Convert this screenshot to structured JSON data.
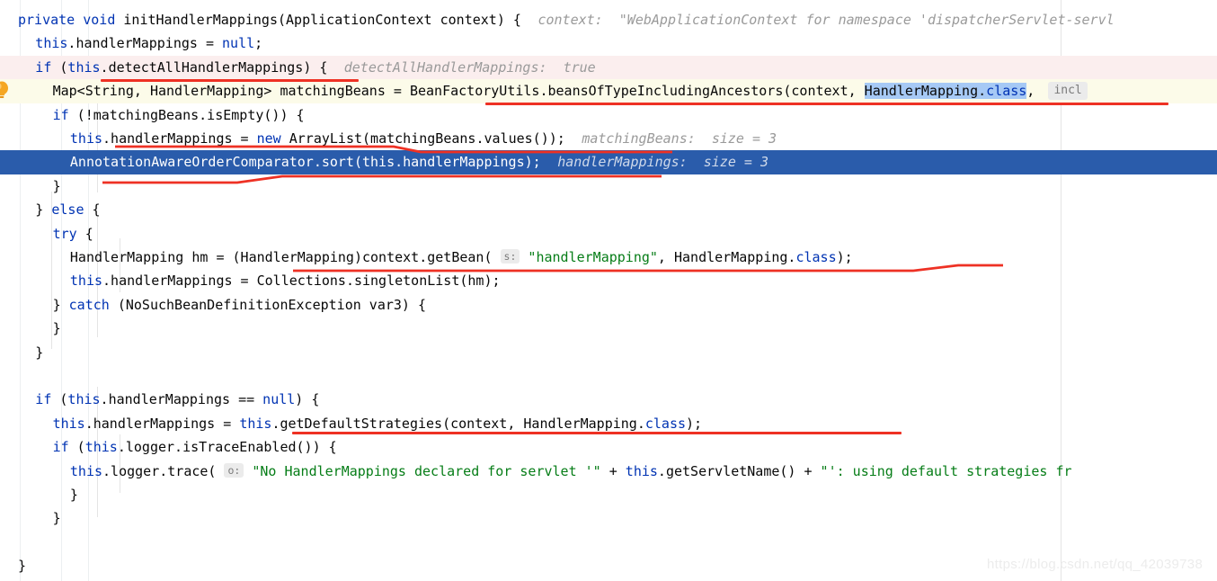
{
  "editor": {
    "language": "java",
    "theme": "IntelliJ Light",
    "colors": {
      "background": "#ffffff",
      "keyword": "#0033b3",
      "string": "#067d17",
      "number": "#1750eb",
      "plain_text": "#080808",
      "inline_hint": "#9a9a9a",
      "selected_line_bg": "#2a5cab",
      "selected_line_fg": "#ffffff",
      "text_selection_bg": "#a6c9f5",
      "breakpoint_hit_row_bg": "#fcfbe9",
      "execution_row_bg": "#fbeeee",
      "annotation_red": "#ee3124",
      "indent_guide": "#e4e4e4",
      "gutter_separator": "#eceff1"
    }
  },
  "gutter": {
    "intention_icon": "lightbulb-icon",
    "intention_icon_color": "#f5a623"
  },
  "watermark": {
    "text": "https://blog.csdn.net/qq_42039738"
  },
  "code_lines": [
    {
      "id": 1,
      "indent": 0,
      "row_style": "normal",
      "tokens": [
        {
          "t": "private",
          "c": "kw"
        },
        {
          "t": " ",
          "c": "plain"
        },
        {
          "t": "void",
          "c": "kw"
        },
        {
          "t": " initHandlerMappings(ApplicationContext context) {",
          "c": "plain"
        }
      ],
      "hint": "context:  \"WebApplicationContext for namespace 'dispatcherServlet-servl"
    },
    {
      "id": 2,
      "indent": 1,
      "row_style": "normal",
      "tokens": [
        {
          "t": "this",
          "c": "kw"
        },
        {
          "t": ".handlerMappings = ",
          "c": "plain"
        },
        {
          "t": "null",
          "c": "kw"
        },
        {
          "t": ";",
          "c": "plain"
        }
      ],
      "hint": ""
    },
    {
      "id": 3,
      "indent": 1,
      "row_style": "pink",
      "tokens": [
        {
          "t": "if",
          "c": "kw"
        },
        {
          "t": " (",
          "c": "plain"
        },
        {
          "t": "this",
          "c": "kw"
        },
        {
          "t": ".detectAllHandlerMappings) {",
          "c": "plain"
        }
      ],
      "hint": "detectAllHandlerMappings:  true"
    },
    {
      "id": 4,
      "indent": 2,
      "row_style": "cream",
      "tokens": [
        {
          "t": "Map<String, HandlerMapping> matchingBeans = BeanFactoryUtils.beansOfTypeIncludingAncestors(context, ",
          "c": "plain"
        },
        {
          "t": "HandlerMapping.",
          "c": "plain",
          "sel": true
        },
        {
          "t": "class",
          "c": "kw",
          "sel": true
        },
        {
          "t": ",",
          "c": "plain"
        }
      ],
      "hint_chip": "incl"
    },
    {
      "id": 5,
      "indent": 2,
      "row_style": "normal",
      "tokens": [
        {
          "t": "if",
          "c": "kw"
        },
        {
          "t": " (!matchingBeans.isEmpty()) {",
          "c": "plain"
        }
      ],
      "hint": ""
    },
    {
      "id": 6,
      "indent": 3,
      "row_style": "normal",
      "tokens": [
        {
          "t": "this",
          "c": "kw"
        },
        {
          "t": ".handlerMappings = ",
          "c": "plain"
        },
        {
          "t": "new",
          "c": "kw"
        },
        {
          "t": " ArrayList(matchingBeans.values());",
          "c": "plain"
        }
      ],
      "hint": "matchingBeans:  size = 3"
    },
    {
      "id": 7,
      "indent": 3,
      "row_style": "selected",
      "tokens": [
        {
          "t": "AnnotationAwareOrderComparator.sort(this.handlerMappings);",
          "c": "plain"
        }
      ],
      "hint": "handlerMappings:  size = 3"
    },
    {
      "id": 8,
      "indent": 2,
      "row_style": "normal",
      "tokens": [
        {
          "t": "}",
          "c": "plain"
        }
      ],
      "hint": ""
    },
    {
      "id": 9,
      "indent": 1,
      "row_style": "normal",
      "tokens": [
        {
          "t": "} ",
          "c": "plain"
        },
        {
          "t": "else",
          "c": "kw"
        },
        {
          "t": " {",
          "c": "plain"
        }
      ],
      "hint": ""
    },
    {
      "id": 10,
      "indent": 2,
      "row_style": "normal",
      "tokens": [
        {
          "t": "try",
          "c": "kw"
        },
        {
          "t": " {",
          "c": "plain"
        }
      ],
      "hint": ""
    },
    {
      "id": 11,
      "indent": 3,
      "row_style": "normal",
      "tokens": [
        {
          "t": "HandlerMapping hm = (HandlerMapping)context.getBean( ",
          "c": "plain"
        },
        {
          "t": "s:",
          "c": "chip"
        },
        {
          "t": " ",
          "c": "plain"
        },
        {
          "t": "\"handlerMapping\"",
          "c": "str"
        },
        {
          "t": ", HandlerMapping.",
          "c": "plain"
        },
        {
          "t": "class",
          "c": "kw"
        },
        {
          "t": ");",
          "c": "plain"
        }
      ],
      "hint": ""
    },
    {
      "id": 12,
      "indent": 3,
      "row_style": "normal",
      "tokens": [
        {
          "t": "this",
          "c": "kw"
        },
        {
          "t": ".handlerMappings = Collections.singletonList(hm);",
          "c": "plain"
        }
      ],
      "hint": ""
    },
    {
      "id": 13,
      "indent": 2,
      "row_style": "normal",
      "tokens": [
        {
          "t": "} ",
          "c": "plain"
        },
        {
          "t": "catch",
          "c": "kw"
        },
        {
          "t": " (NoSuchBeanDefinitionException var3) {",
          "c": "plain"
        }
      ],
      "hint": ""
    },
    {
      "id": 14,
      "indent": 2,
      "row_style": "normal",
      "tokens": [
        {
          "t": "}",
          "c": "plain"
        }
      ],
      "hint": ""
    },
    {
      "id": 15,
      "indent": 1,
      "row_style": "normal",
      "tokens": [
        {
          "t": "}",
          "c": "plain"
        }
      ],
      "hint": ""
    },
    {
      "id": 16,
      "indent": 0,
      "row_style": "normal",
      "tokens": [],
      "hint": ""
    },
    {
      "id": 17,
      "indent": 1,
      "row_style": "normal",
      "tokens": [
        {
          "t": "if",
          "c": "kw"
        },
        {
          "t": " (",
          "c": "plain"
        },
        {
          "t": "this",
          "c": "kw"
        },
        {
          "t": ".handlerMappings == ",
          "c": "plain"
        },
        {
          "t": "null",
          "c": "kw"
        },
        {
          "t": ") {",
          "c": "plain"
        }
      ],
      "hint": ""
    },
    {
      "id": 18,
      "indent": 2,
      "row_style": "normal",
      "tokens": [
        {
          "t": "this",
          "c": "kw"
        },
        {
          "t": ".handlerMappings = ",
          "c": "plain"
        },
        {
          "t": "this",
          "c": "kw"
        },
        {
          "t": ".getDefaultStrategies(context, HandlerMapping.",
          "c": "plain"
        },
        {
          "t": "class",
          "c": "kw"
        },
        {
          "t": ");",
          "c": "plain"
        }
      ],
      "hint": ""
    },
    {
      "id": 19,
      "indent": 2,
      "row_style": "normal",
      "tokens": [
        {
          "t": "if",
          "c": "kw"
        },
        {
          "t": " (",
          "c": "plain"
        },
        {
          "t": "this",
          "c": "kw"
        },
        {
          "t": ".logger.isTraceEnabled()) {",
          "c": "plain"
        }
      ],
      "hint": ""
    },
    {
      "id": 20,
      "indent": 3,
      "row_style": "normal",
      "tokens": [
        {
          "t": "this",
          "c": "kw"
        },
        {
          "t": ".logger.trace( ",
          "c": "plain"
        },
        {
          "t": "o:",
          "c": "chip"
        },
        {
          "t": " ",
          "c": "plain"
        },
        {
          "t": "\"No HandlerMappings declared for servlet '\"",
          "c": "str"
        },
        {
          "t": " + ",
          "c": "plain"
        },
        {
          "t": "this",
          "c": "kw"
        },
        {
          "t": ".getServletName() + ",
          "c": "plain"
        },
        {
          "t": "\"': using default strategies fr",
          "c": "str"
        }
      ],
      "hint": ""
    },
    {
      "id": 21,
      "indent": 3,
      "row_style": "normal",
      "tokens": [
        {
          "t": "}",
          "c": "plain"
        }
      ],
      "hint": ""
    },
    {
      "id": 22,
      "indent": 2,
      "row_style": "normal",
      "tokens": [
        {
          "t": "}",
          "c": "plain"
        }
      ],
      "hint": ""
    },
    {
      "id": 23,
      "indent": 0,
      "row_style": "normal",
      "tokens": [],
      "hint": ""
    },
    {
      "id": 24,
      "indent": 0,
      "row_style": "normal",
      "tokens": [
        {
          "t": "}",
          "c": "plain"
        }
      ],
      "hint": ""
    }
  ],
  "annotations": [
    {
      "name": "underline-detectAllHandlerMappings"
    },
    {
      "name": "underline-beansOfTypeIncludingAncestors"
    },
    {
      "name": "underline-new-arraylist"
    },
    {
      "name": "underline-annotationaware-sort"
    },
    {
      "name": "underline-getbean-handlermapping"
    },
    {
      "name": "underline-getdefaultstrategies"
    }
  ]
}
